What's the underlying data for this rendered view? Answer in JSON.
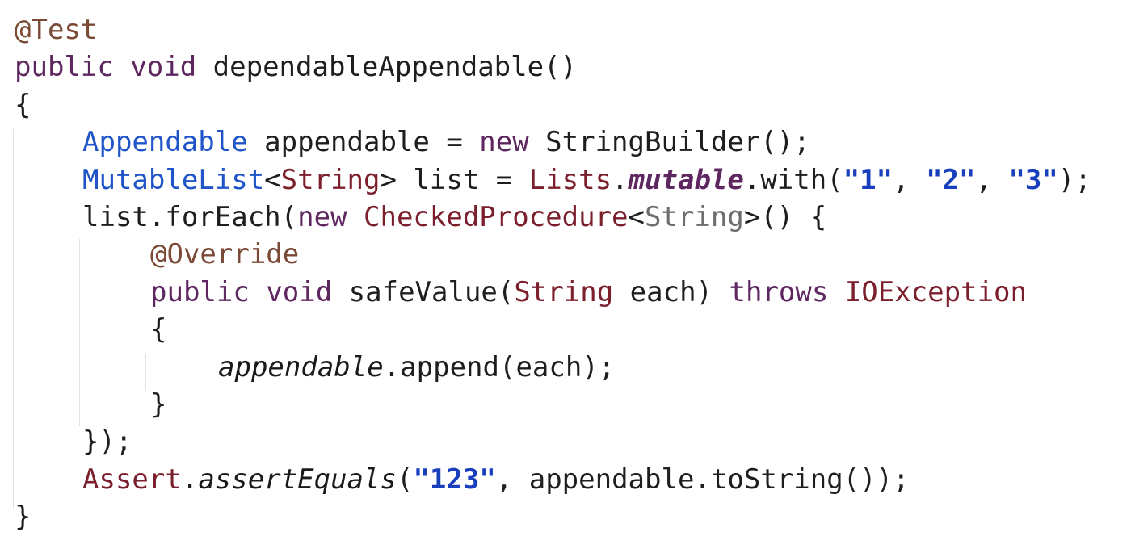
{
  "editor": {
    "lines": [
      {
        "indent": 0,
        "tokens": [
          {
            "t": "@Test",
            "c": "annot"
          }
        ]
      },
      {
        "indent": 0,
        "tokens": [
          {
            "t": "public",
            "c": "kw"
          },
          {
            "t": " ",
            "c": "plain"
          },
          {
            "t": "void",
            "c": "kw"
          },
          {
            "t": " dependableAppendable()",
            "c": "plain"
          }
        ]
      },
      {
        "indent": 0,
        "tokens": [
          {
            "t": "{",
            "c": "plain"
          }
        ]
      },
      {
        "indent": 1,
        "tokens": [
          {
            "t": "Appendable",
            "c": "type"
          },
          {
            "t": " appendable = ",
            "c": "plain"
          },
          {
            "t": "new",
            "c": "kw"
          },
          {
            "t": " StringBuilder();",
            "c": "plain"
          }
        ]
      },
      {
        "indent": 1,
        "tokens": [
          {
            "t": "MutableList",
            "c": "type"
          },
          {
            "t": "<",
            "c": "plain"
          },
          {
            "t": "String",
            "c": "class"
          },
          {
            "t": "> list = ",
            "c": "plain"
          },
          {
            "t": "Lists",
            "c": "class"
          },
          {
            "t": ".",
            "c": "plain"
          },
          {
            "t": "mutable",
            "c": "field-bold"
          },
          {
            "t": ".with(",
            "c": "plain"
          },
          {
            "t": "\"1\"",
            "c": "string"
          },
          {
            "t": ", ",
            "c": "plain"
          },
          {
            "t": "\"2\"",
            "c": "string"
          },
          {
            "t": ", ",
            "c": "plain"
          },
          {
            "t": "\"3\"",
            "c": "string"
          },
          {
            "t": ");",
            "c": "plain"
          }
        ]
      },
      {
        "indent": 1,
        "tokens": [
          {
            "t": "list.forEach(",
            "c": "plain"
          },
          {
            "t": "new",
            "c": "kw"
          },
          {
            "t": " ",
            "c": "plain"
          },
          {
            "t": "CheckedProcedure",
            "c": "class"
          },
          {
            "t": "<",
            "c": "plain"
          },
          {
            "t": "String",
            "c": "generic-grey"
          },
          {
            "t": ">() {",
            "c": "plain"
          }
        ]
      },
      {
        "indent": 2,
        "tokens": [
          {
            "t": "@Override",
            "c": "annot"
          }
        ]
      },
      {
        "indent": 2,
        "tokens": [
          {
            "t": "public",
            "c": "kw"
          },
          {
            "t": " ",
            "c": "plain"
          },
          {
            "t": "void",
            "c": "kw"
          },
          {
            "t": " safeValue(",
            "c": "plain"
          },
          {
            "t": "String",
            "c": "class"
          },
          {
            "t": " each) ",
            "c": "plain"
          },
          {
            "t": "throws",
            "c": "kw"
          },
          {
            "t": " ",
            "c": "plain"
          },
          {
            "t": "IOException",
            "c": "class"
          }
        ]
      },
      {
        "indent": 2,
        "tokens": [
          {
            "t": "{",
            "c": "plain"
          }
        ]
      },
      {
        "indent": 3,
        "tokens": [
          {
            "t": "appendable",
            "c": "italic"
          },
          {
            "t": ".append(each);",
            "c": "plain"
          }
        ]
      },
      {
        "indent": 2,
        "tokens": [
          {
            "t": "}",
            "c": "plain"
          }
        ]
      },
      {
        "indent": 1,
        "tokens": [
          {
            "t": "});",
            "c": "plain"
          }
        ]
      },
      {
        "indent": 1,
        "tokens": [
          {
            "t": "Assert",
            "c": "class"
          },
          {
            "t": ".",
            "c": "plain"
          },
          {
            "t": "assertEquals",
            "c": "italic"
          },
          {
            "t": "(",
            "c": "plain"
          },
          {
            "t": "\"123\"",
            "c": "string"
          },
          {
            "t": ", appendable.toString());",
            "c": "plain"
          }
        ]
      },
      {
        "indent": 0,
        "tokens": [
          {
            "t": "}",
            "c": "plain"
          }
        ]
      }
    ]
  }
}
